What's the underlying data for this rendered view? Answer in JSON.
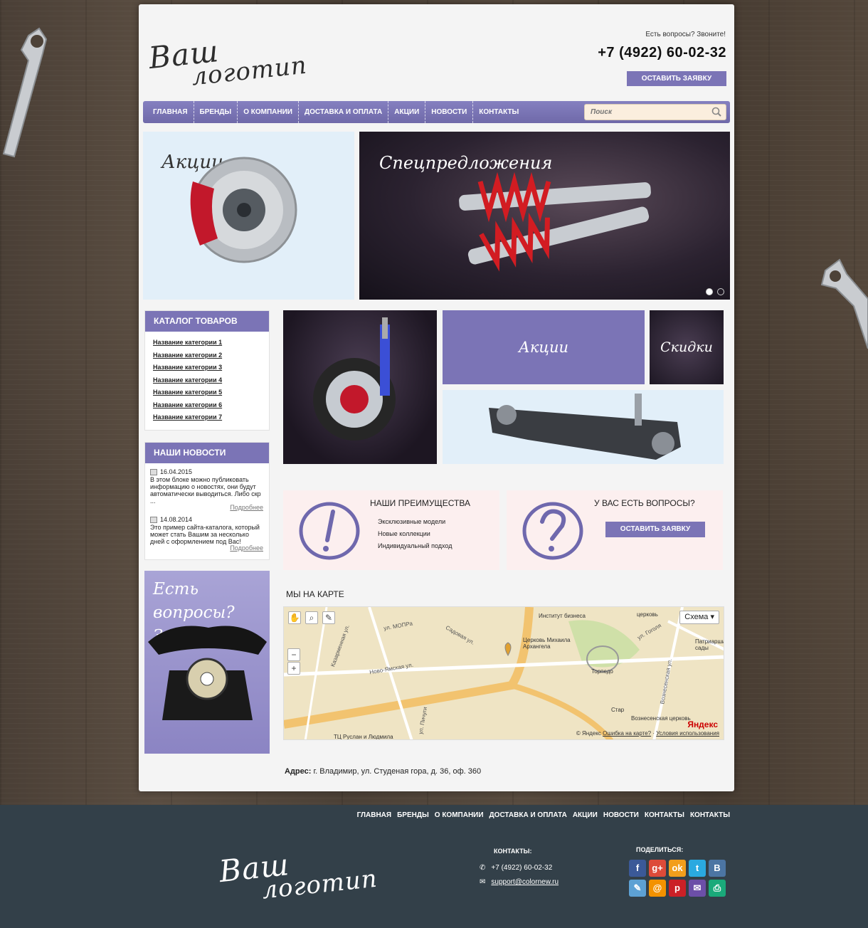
{
  "header": {
    "logo_line1": "Ваш",
    "logo_line2": "логотип",
    "question": "Есть вопросы? Звоните!",
    "phone": "+7 (4922) 60-02-32",
    "request_button": "ОСТАВИТЬ ЗАЯВКУ"
  },
  "nav": {
    "items": [
      "ГЛАВНАЯ",
      "БРЕНДЫ",
      "О КОМПАНИИ",
      "ДОСТАВКА И ОПЛАТА",
      "АКЦИИ",
      "НОВОСТИ",
      "КОНТАКТЫ"
    ],
    "search_placeholder": "Поиск"
  },
  "banners": {
    "promo": "Акции",
    "special": "Спецпредложения"
  },
  "catalog": {
    "title": "КАТАЛОГ ТОВАРОВ",
    "items": [
      "Название категории 1",
      "Название категории 2",
      "Название категории 3",
      "Название категории 4",
      "Название категории 5",
      "Название категории 6",
      "Название категории 7"
    ]
  },
  "news": {
    "title": "НАШИ НОВОСТИ",
    "items": [
      {
        "date": "16.04.2015",
        "text": "В этом блоке можно публиковать информацию о новостях, они будут автоматически выводиться. Либо скр ...",
        "more": "Подробнее"
      },
      {
        "date": "14.08.2014",
        "text": "Это пример сайта-каталога, который может стать Вашим за несколько дней с оформлением под Вас!",
        "more": "Подробнее"
      }
    ]
  },
  "call_banner": {
    "line1": "Есть вопросы?",
    "line2": "Звоните!"
  },
  "tiles": {
    "akcii": "Акции",
    "skidki": "Скидки"
  },
  "advantages": {
    "title": "НАШИ ПРЕИМУЩЕСТВА",
    "items": [
      "Эксклюзивные модели",
      "Новые коллекции",
      "Индивидуальный подход"
    ]
  },
  "questions": {
    "title": "У ВАС ЕСТЬ ВОПРОСЫ?",
    "button": "ОСТАВИТЬ ЗАЯВКУ"
  },
  "map": {
    "title": "МЫ НА КАРТЕ",
    "scheme": "Схема",
    "labels": [
      "ул. МОПРа",
      "Садовая ул.",
      "Казарменная ул.",
      "Ново-Ямская ул.",
      "Институт бизнеса",
      "Церковь Михаила Архангела",
      "Торпедо",
      "ул. Гоголя",
      "Вознесенская ул.",
      "Вознесенская церковь",
      "Патриаршие сады",
      "ул. Пичуги",
      "ТЦ Руслан и Людмила",
      "Стар",
      "церковь"
    ],
    "copyright": "© Яндекс",
    "error_link": "Ошибка на карте?",
    "terms_link": "Условия использования",
    "brand": "Яндекс"
  },
  "address": {
    "label": "Адрес:",
    "value": " г. Владимир, ул. Студеная гора, д. 36, оф. 360"
  },
  "footer": {
    "nav": [
      "ГЛАВНАЯ",
      "БРЕНДЫ",
      "О КОМПАНИИ",
      "ДОСТАВКА И ОПЛАТА",
      "АКЦИИ",
      "НОВОСТИ",
      "КОНТАКТЫ",
      "КОНТАКТЫ"
    ],
    "contacts_title": "КОНТАКТЫ:",
    "phone": "+7 (4922) 60-02-32",
    "email": "support@colornew.ru",
    "share_title": "ПОДЕЛИТЬСЯ:",
    "socials": [
      {
        "name": "facebook-icon",
        "glyph": "f",
        "color": "#3b5998"
      },
      {
        "name": "google-plus-icon",
        "glyph": "g+",
        "color": "#dd4b39"
      },
      {
        "name": "odnoklassniki-icon",
        "glyph": "ok",
        "color": "#f29e1c"
      },
      {
        "name": "twitter-icon",
        "glyph": "t",
        "color": "#2aa9e0"
      },
      {
        "name": "vk-icon",
        "glyph": "В",
        "color": "#4c75a3"
      },
      {
        "name": "livejournal-icon",
        "glyph": "✎",
        "color": "#5da1d4"
      },
      {
        "name": "mailru-icon",
        "glyph": "@",
        "color": "#f39200"
      },
      {
        "name": "pinterest-icon",
        "glyph": "p",
        "color": "#cb2027"
      },
      {
        "name": "email-share-icon",
        "glyph": "✉",
        "color": "#6c4fa8"
      },
      {
        "name": "print-icon",
        "glyph": "⎙",
        "color": "#1aaa7a"
      }
    ]
  }
}
